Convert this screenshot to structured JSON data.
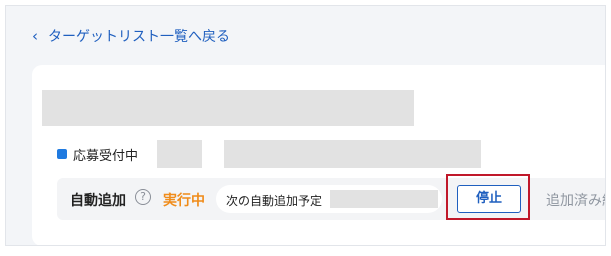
{
  "nav": {
    "back_chevron": "‹",
    "back_label": "ターゲットリスト一覧へ戻る"
  },
  "status": {
    "label": "応募受付中",
    "indicator_color": "#1f7ae0"
  },
  "auto_add": {
    "label": "自動追加",
    "help_icon": "?",
    "run_status": "実行中",
    "next_label": "次の自動追加予定",
    "stop_button": "停止",
    "total_label": "追加済み総数"
  },
  "colors": {
    "link": "#1f5fbf",
    "running": "#f08c1a",
    "highlight": "#c0182a",
    "placeholder": "#e2e2e2"
  }
}
